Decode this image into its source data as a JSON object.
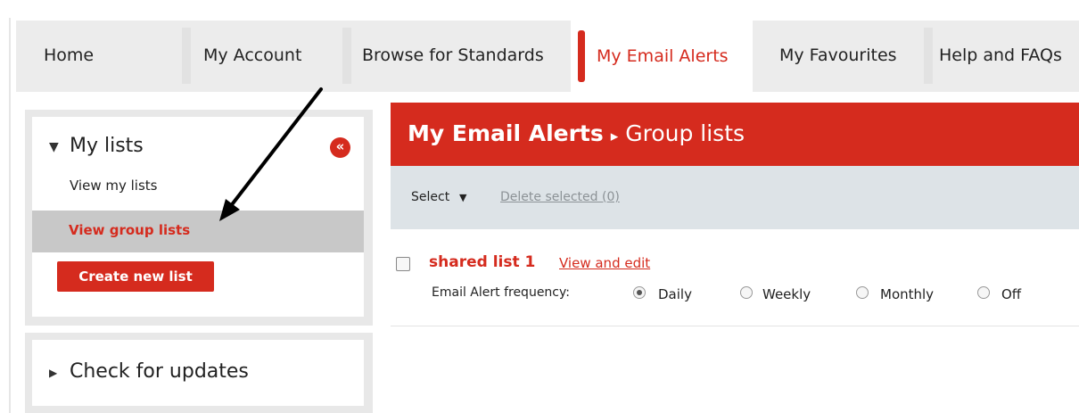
{
  "nav": {
    "tabs": [
      {
        "label": "Home"
      },
      {
        "label": "My Account"
      },
      {
        "label": "Browse for Standards"
      },
      {
        "label": "My Email Alerts",
        "active": true
      },
      {
        "label": "My Favourites"
      },
      {
        "label": "Help and FAQs"
      }
    ]
  },
  "sidebar": {
    "my_lists": {
      "title": "My lists",
      "expanded": true,
      "collapse_icon": "double-chevron-left-icon",
      "view_my_lists": "View my lists",
      "view_group_lists": "View group lists",
      "create_button": "Create new list"
    },
    "check_updates": {
      "title": "Check for updates",
      "expanded": false
    }
  },
  "main": {
    "header": {
      "section": "My Email Alerts",
      "separator": "▸",
      "page": "Group lists"
    },
    "toolbar": {
      "select_label": "Select",
      "delete_label": "Delete selected (0)"
    },
    "list": {
      "name": "shared list 1",
      "action": "View and edit",
      "checked": false,
      "frequency_label": "Email Alert frequency:",
      "options": [
        "Daily",
        "Weekly",
        "Monthly",
        "Off"
      ],
      "selected": "Daily"
    }
  },
  "colors": {
    "accent": "#d52b1e",
    "nav_bg": "#ececec",
    "toolbar_bg": "#dde3e7",
    "highlight_row": "#c8c8c8"
  }
}
